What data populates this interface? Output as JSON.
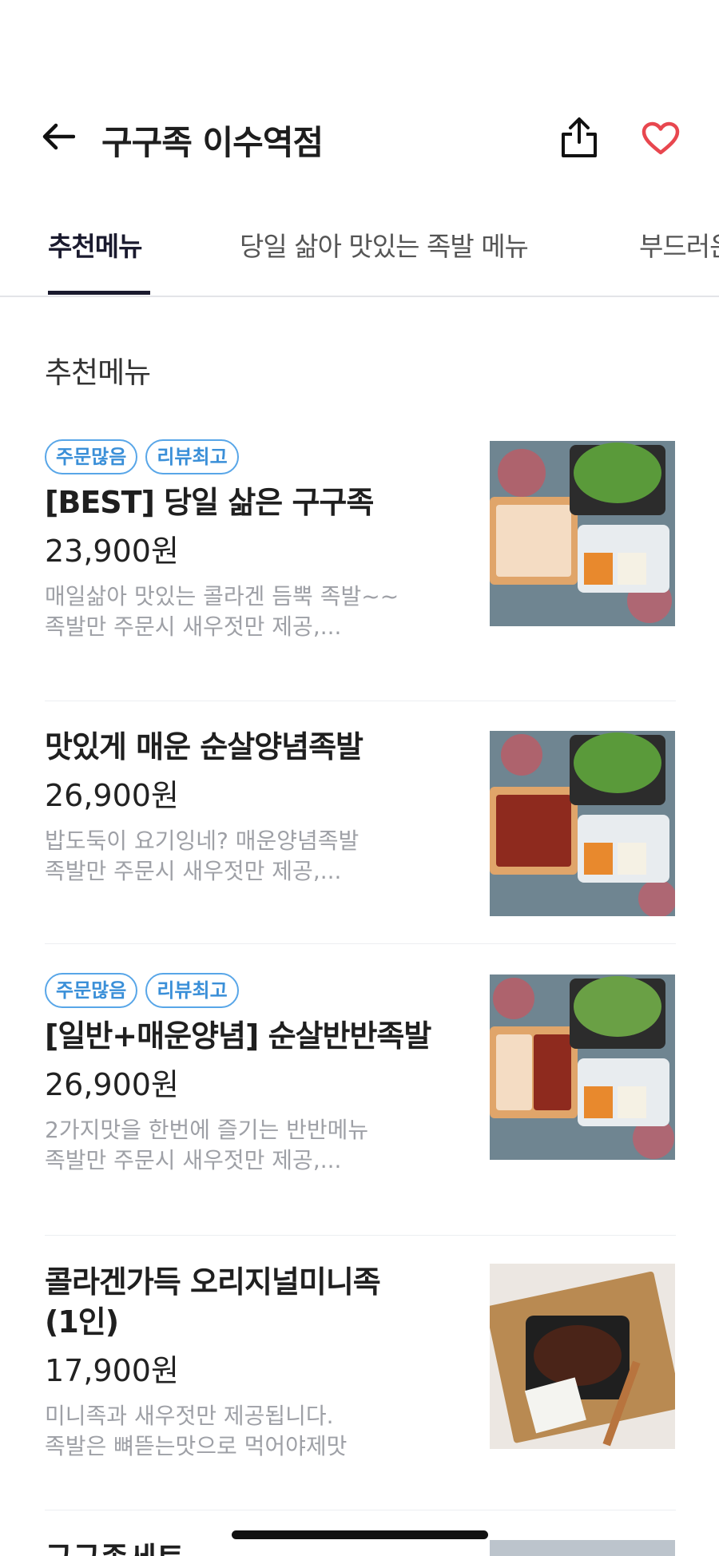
{
  "header": {
    "title": "구구족 이수역점",
    "back_icon": "arrow-left-icon",
    "share_icon": "share-icon",
    "favorite_icon": "heart-icon",
    "favorite_color": "#e8474f"
  },
  "tabs": [
    {
      "label": "추천메뉴",
      "active": true
    },
    {
      "label": "당일 삶아 맛있는 족발 메뉴",
      "active": false
    },
    {
      "label": "부드러운",
      "active": false
    }
  ],
  "section": {
    "title": "추천메뉴"
  },
  "menu": [
    {
      "badges": [
        "주문많음",
        "리뷰최고"
      ],
      "name": "[BEST] 당일 삶은 구구족",
      "price": "23,900원",
      "description": "매일삶아 맛있는 콜라겐 듬뿍 족발~~\n족발만 주문시 새우젓만 제공,..."
    },
    {
      "badges": [],
      "name": "맛있게 매운 순살양념족발",
      "price": "26,900원",
      "description": "밥도둑이 요기잉네? 매운양념족발\n족발만 주문시 새우젓만 제공,..."
    },
    {
      "badges": [
        "주문많음",
        "리뷰최고"
      ],
      "name": "[일반+매운양념] 순살반반족발",
      "price": "26,900원",
      "description": "2가지맛을 한번에 즐기는 반반메뉴\n족발만 주문시 새우젓만 제공,..."
    },
    {
      "badges": [],
      "name": "콜라겐가득 오리지널미니족\n(1인)",
      "price": "17,900원",
      "description": "미니족과 새우젓만 제공됩니다.\n족발은 뼈뜯는맛으로 먹어야제맛"
    }
  ],
  "next_item_partial": {
    "name": "구구족세트"
  },
  "colors": {
    "badge_border": "#58a6e8",
    "active_tab": "#1a1a2e",
    "description": "#9ea0a6"
  }
}
